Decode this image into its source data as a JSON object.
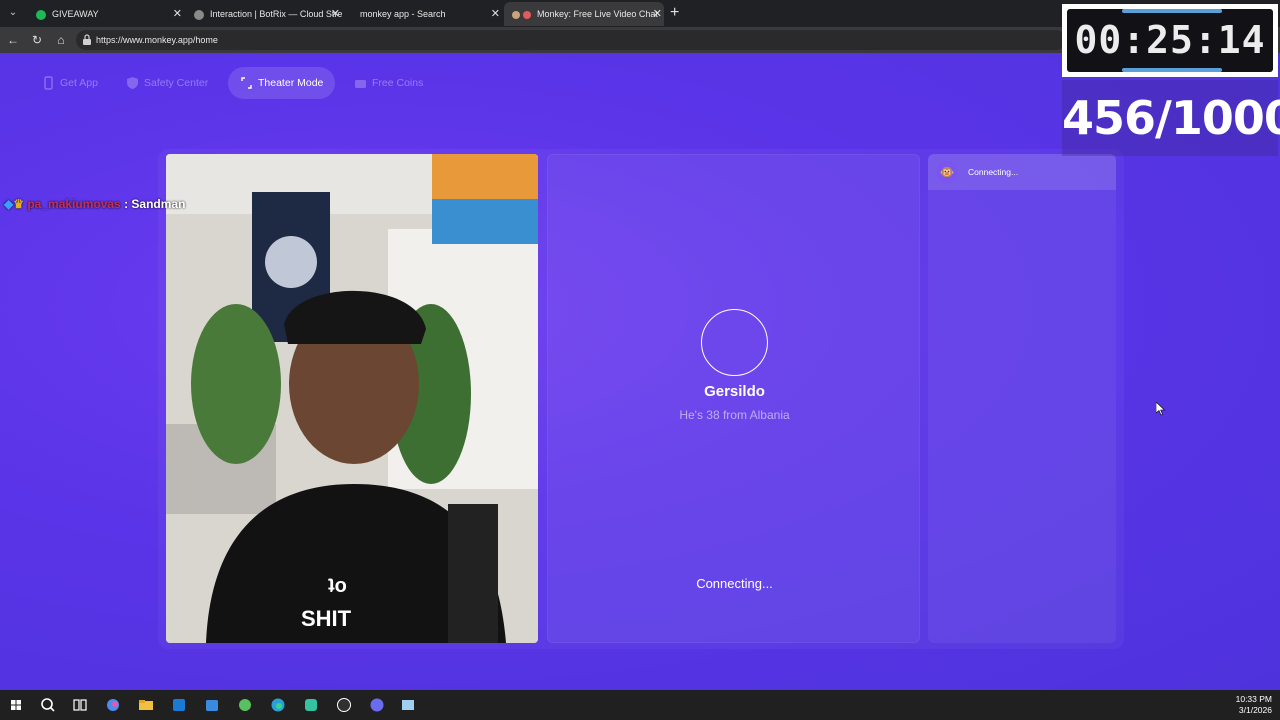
{
  "browser": {
    "tabs": [
      {
        "label": "GIVEAWAY"
      },
      {
        "label": "Interaction | BotRix — Cloud Strea"
      },
      {
        "label": "monkey app - Search"
      },
      {
        "label": "Monkey: Free Live Video Chat"
      }
    ],
    "url": "https://www.monkey.app/home"
  },
  "nav": {
    "get_app": "Get App",
    "safety_center": "Safety Center",
    "theater_mode": "Theater Mode",
    "free_coins": "Free Coins"
  },
  "partner": {
    "name": "Gersildo",
    "info": "He's 38 from Albania",
    "status": "Connecting..."
  },
  "chat": {
    "header_label": "Connecting..."
  },
  "overlay_chat": {
    "user": "pa_makiumovas",
    "message": ": Sandman"
  },
  "stream_overlay": {
    "timer": "00:25:14",
    "counter": "456/1000"
  },
  "taskbar": {
    "time": "10:33 PM",
    "date": "3/1/2026"
  },
  "colors": {
    "page_bg": "#5a34e8",
    "accent_timer": "#5aa0d8"
  }
}
